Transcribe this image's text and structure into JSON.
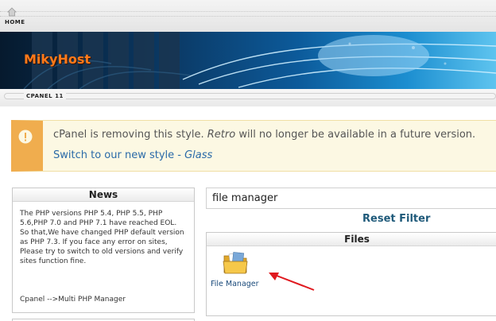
{
  "topnav": {
    "home_label": "HOME"
  },
  "banner": {
    "brand": "MikyHost"
  },
  "cpanel_strip": {
    "label": "CPANEL 11"
  },
  "warning": {
    "prefix": "cPanel is removing this style. ",
    "style_name": "Retro",
    "suffix": " will no longer be available in a future version.",
    "link_prefix": "Switch to our new style - ",
    "link_style": "Glass"
  },
  "news": {
    "title": "News",
    "body": "The PHP versions PHP 5.4, PHP 5.5, PHP 5.6,PHP 7.0 and PHP 7.1 have reached EOL. So that,We have changed PHP default version as PHP 7.3. If you face any error on sites, Please try to switch to old versions and verify sites function fine.",
    "footer": "Cpanel -->Multi PHP Manager"
  },
  "search": {
    "value": "file manager"
  },
  "reset_filter": "Reset Filter",
  "files": {
    "title": "Files",
    "items": [
      {
        "label": "File Manager",
        "icon": "folder-icon"
      }
    ]
  },
  "colors": {
    "warning_accent": "#f0ad4e",
    "brand": "#ff7a1a",
    "link": "#2a6aa8",
    "reset": "#1f5a7a",
    "annotation_arrow": "#e0191f"
  }
}
